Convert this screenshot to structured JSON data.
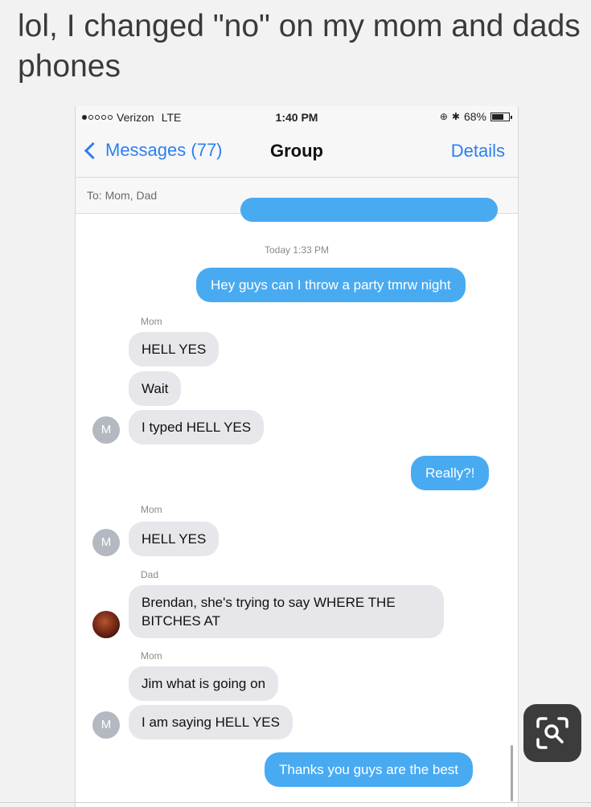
{
  "caption": "lol, I changed \"no\" on my mom and dads phones",
  "status_bar": {
    "carrier": "Verizon",
    "network": "LTE",
    "time": "1:40 PM",
    "battery": "68%",
    "battery_level": 0.68
  },
  "nav": {
    "back_label": "Messages (77)",
    "title": "Group",
    "details_label": "Details"
  },
  "recipients": "To: Mom, Dad",
  "timestamp": "Today 1:33 PM",
  "messages": [
    {
      "from": "me",
      "text": "Hey guys can I throw a party tmrw night"
    },
    {
      "sender_label": "Mom"
    },
    {
      "from": "Mom",
      "text": "HELL YES"
    },
    {
      "from": "Mom",
      "text": "Wait"
    },
    {
      "from": "Mom",
      "text": "I typed HELL YES",
      "avatar": "M"
    },
    {
      "from": "me",
      "text": "Really?!"
    },
    {
      "sender_label": "Mom"
    },
    {
      "from": "Mom",
      "text": "HELL YES",
      "avatar": "M"
    },
    {
      "sender_label": "Dad"
    },
    {
      "from": "Dad",
      "text": "Brendan, she's trying to say WHERE THE BITCHES AT"
    },
    {
      "sender_label": "Mom"
    },
    {
      "from": "Mom",
      "text": "Jim what is going on"
    },
    {
      "from": "Mom",
      "text": "I am saying HELL YES",
      "avatar": "M"
    },
    {
      "from": "me",
      "text": "Thanks you guys are the best"
    }
  ],
  "colors": {
    "outgoing_bubble": "#48abf2",
    "incoming_bubble": "#e6e6eb",
    "ios_blue": "#2d7ff0",
    "avatar_gray": "#b4b8c0"
  },
  "icons": {
    "back": "chevron-left-icon",
    "lens": "visual-search-icon"
  }
}
